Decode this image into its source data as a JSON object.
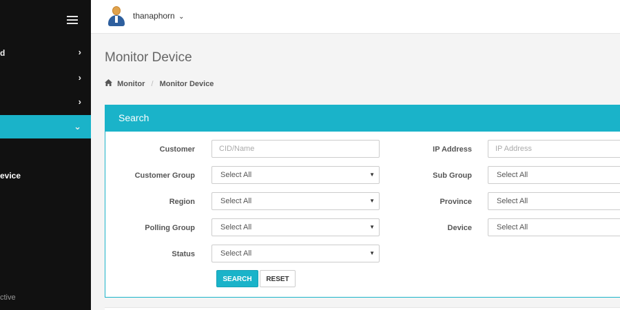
{
  "sidebar": {
    "items": [
      {
        "label": "d",
        "icon": "chevron-right-icon"
      },
      {
        "label": "",
        "icon": "chevron-right-icon"
      },
      {
        "label": "",
        "icon": "chevron-right-icon"
      },
      {
        "label": "",
        "icon": "chevron-down-icon"
      }
    ],
    "sub_item": "evice",
    "footer": "ctive",
    "accent": "#1ab3c9"
  },
  "header": {
    "username": "thanaphorn",
    "caret": "⌄"
  },
  "page": {
    "title": "Monitor Device",
    "breadcrumb": [
      "Monitor",
      "Monitor Device"
    ],
    "breadcrumb_sep": "/"
  },
  "search": {
    "title": "Search",
    "fields": {
      "customer": {
        "label": "Customer",
        "placeholder": "CID/Name"
      },
      "customer_group": {
        "label": "Customer Group",
        "value": "Select All"
      },
      "region": {
        "label": "Region",
        "value": "Select All"
      },
      "polling_group": {
        "label": "Polling Group",
        "value": "Select All"
      },
      "status": {
        "label": "Status",
        "value": "Select All"
      },
      "ip_address": {
        "label": "IP Address",
        "placeholder": "IP Address"
      },
      "sub_group": {
        "label": "Sub Group",
        "value": "Select All"
      },
      "province": {
        "label": "Province",
        "value": "Select All"
      },
      "device": {
        "label": "Device",
        "value": "Select All"
      }
    },
    "search_button": "SEARCH",
    "reset_button": "RESET"
  }
}
